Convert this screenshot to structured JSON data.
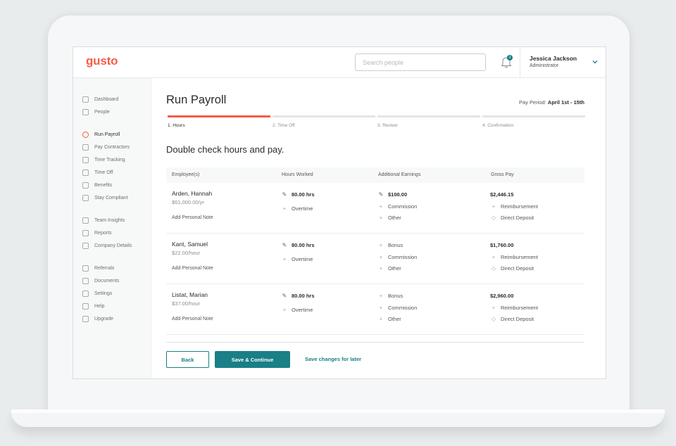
{
  "app": {
    "logo": "gusto"
  },
  "search": {
    "placeholder": "Search people"
  },
  "notifications": {
    "count": "3"
  },
  "user": {
    "name": "Jessica Jackson",
    "role": "Administrator"
  },
  "sidebar": {
    "items": [
      {
        "label": "Dashboard",
        "icon": "home-icon"
      },
      {
        "label": "People",
        "icon": "person-icon"
      },
      {
        "label": "Run Payroll",
        "icon": "dollar-icon",
        "active": true
      },
      {
        "label": "Pay Contractors",
        "icon": "card-icon"
      },
      {
        "label": "Time Tracking",
        "icon": "clock-icon"
      },
      {
        "label": "Time Off",
        "icon": "plane-icon"
      },
      {
        "label": "Benefits",
        "icon": "heart-icon"
      },
      {
        "label": "Stay Compliant",
        "icon": "shield-icon"
      },
      {
        "label": "Team Insights",
        "icon": "chat-icon"
      },
      {
        "label": "Reports",
        "icon": "reports-icon"
      },
      {
        "label": "Company Details",
        "icon": "building-icon"
      },
      {
        "label": "Referrals",
        "icon": "gift-icon"
      },
      {
        "label": "Documents",
        "icon": "document-icon"
      },
      {
        "label": "Settings",
        "icon": "gear-icon"
      },
      {
        "label": "Help",
        "icon": "help-icon"
      },
      {
        "label": "Upgrade",
        "icon": "upgrade-icon"
      }
    ]
  },
  "page": {
    "title": "Run Payroll",
    "pay_period_label": "Pay Period:",
    "pay_period_value": "April 1st - 15th",
    "subtitle": "Double check hours and pay."
  },
  "steps": [
    "1. Hours",
    "2. Time Off",
    "3. Review",
    "4. Confirmation"
  ],
  "table": {
    "headers": [
      "Employee(s)",
      "Hours Worked",
      "Additional Earnings",
      "Gross Pay"
    ],
    "rows": [
      {
        "name": "Arden, Hannah",
        "rate": "$61,000.00/yr",
        "note": "Add Personal Note",
        "hours": "80.00 hrs",
        "overtime": "Overtime",
        "earnings": [
          "$100.00",
          "Commission",
          "Other"
        ],
        "gross": "$2,446.15",
        "reimbursement": "Reimbursement",
        "deposit": "Direct Deposit"
      },
      {
        "name": "Kant, Samuel",
        "rate": "$22.00/hour",
        "note": "Add Personal Note",
        "hours": "80.00 hrs",
        "overtime": "Overtime",
        "earnings": [
          "Bonus",
          "Commission",
          "Other"
        ],
        "gross": "$1,760.00",
        "reimbursement": "Reimbursement",
        "deposit": "Direct Deposit"
      },
      {
        "name": "Listat, Marian",
        "rate": "$37.00/hour",
        "note": "Add Personal Note",
        "hours": "80.00 hrs",
        "overtime": "Overtime",
        "earnings": [
          "Bonus",
          "Commission",
          "Other"
        ],
        "gross": "$2,960.00",
        "reimbursement": "Reimbursement",
        "deposit": "Direct Deposit"
      }
    ]
  },
  "footer": {
    "back": "Back",
    "save_continue": "Save & Continue",
    "save_later": "Save changes for later"
  },
  "colors": {
    "brand": "#f45d48",
    "accent": "#1a7f86"
  }
}
